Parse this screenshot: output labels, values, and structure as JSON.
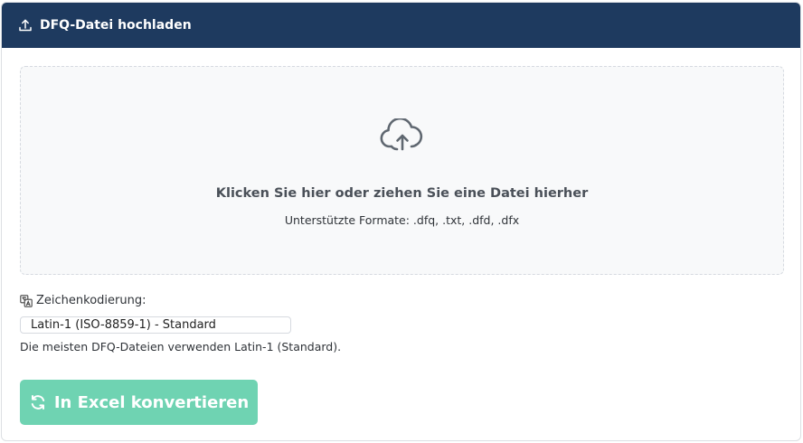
{
  "header": {
    "title": "DFQ-Datei hochladen",
    "icon": "upload-icon",
    "background": "#1e3a5f"
  },
  "dropzone": {
    "icon": "cloud-upload-icon",
    "main_text": "Klicken Sie hier oder ziehen Sie eine Datei hierher",
    "sub_text": "Unterstützte Formate: .dfq, .txt, .dfd, .dfx"
  },
  "encoding": {
    "icon": "translate-icon",
    "label": "Zeichenkodierung:",
    "selected": "Latin-1 (ISO-8859-1) - Standard",
    "hint": "Die meisten DFQ-Dateien verwenden Latin-1 (Standard)."
  },
  "convert_button": {
    "icon": "refresh-icon",
    "label": "In Excel konvertieren",
    "color": "#6fd3b2"
  }
}
